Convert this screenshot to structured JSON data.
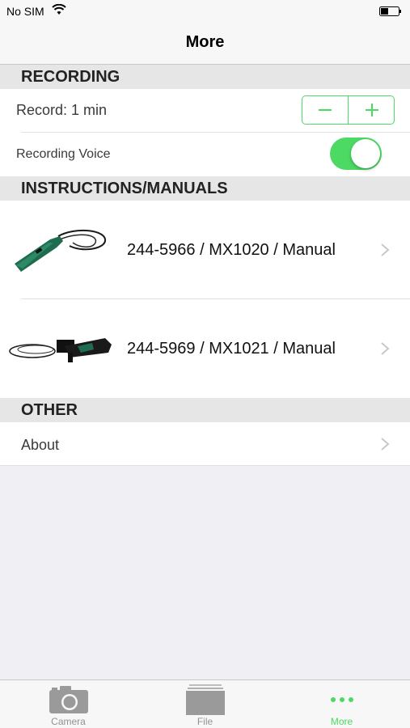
{
  "status_bar": {
    "carrier": "No SIM"
  },
  "nav": {
    "title": "More"
  },
  "sections": {
    "recording": {
      "header": "RECORDING",
      "record_label": "Record: 1 min",
      "stepper_minus": "−",
      "stepper_plus": "+",
      "voice_label": "Recording Voice",
      "voice_enabled": true
    },
    "manuals": {
      "header": "INSTRUCTIONS/MANUALS",
      "items": [
        {
          "label": "244-5966 / MX1020 / Manual"
        },
        {
          "label": "244-5969 / MX1021 / Manual"
        }
      ]
    },
    "other": {
      "header": "OTHER",
      "about_label": "About"
    }
  },
  "tab_bar": {
    "tabs": [
      {
        "label": "Camera",
        "icon": "camera-icon",
        "active": false
      },
      {
        "label": "File",
        "icon": "file-icon",
        "active": false
      },
      {
        "label": "More",
        "icon": "more-icon",
        "active": true
      }
    ]
  },
  "colors": {
    "accent": "#4cd964",
    "section_bg": "#e6e6e6",
    "background": "#efeff4"
  }
}
